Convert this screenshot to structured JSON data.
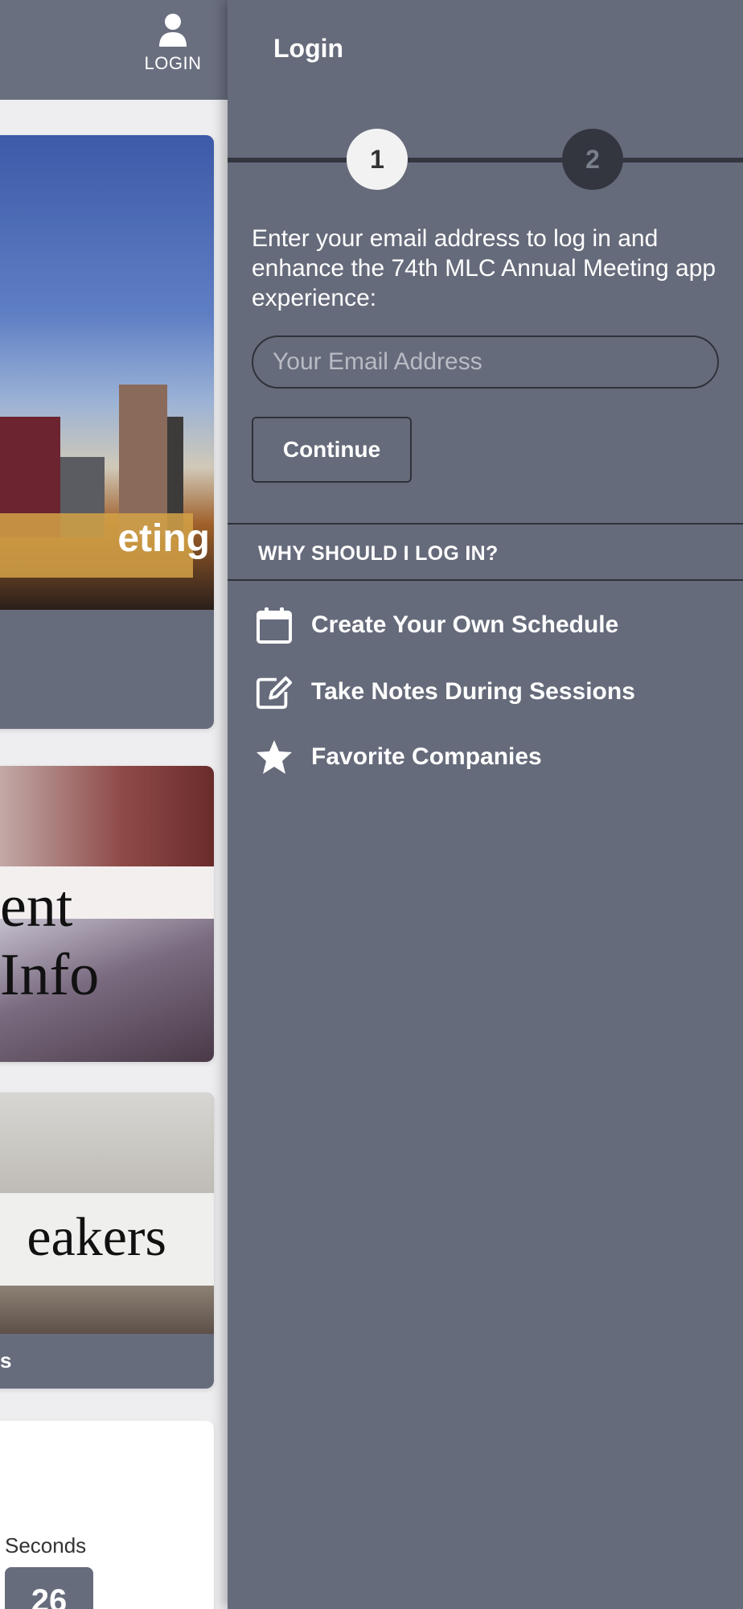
{
  "header": {
    "login_label": "LOGIN"
  },
  "cards": {
    "city_title": "eting",
    "info_title": "ent Info",
    "speakers_title": "eakers",
    "speakers_sub": "s",
    "countdown_label": "Seconds",
    "countdown_value": "26"
  },
  "login_panel": {
    "title": "Login",
    "steps": [
      "1",
      "2"
    ],
    "active_step": 1,
    "intro": "Enter your email address to log in and enhance the 74th MLC Annual Meeting app experience:",
    "email_placeholder": "Your Email Address",
    "email_value": "",
    "continue_label": "Continue",
    "why_header": "WHY SHOULD I LOG IN?",
    "benefits": [
      {
        "icon": "calendar-icon",
        "label": "Create Your Own Schedule"
      },
      {
        "icon": "edit-note-icon",
        "label": "Take Notes During Sessions"
      },
      {
        "icon": "star-icon",
        "label": "Favorite Companies"
      }
    ]
  },
  "colors": {
    "panel_bg": "#666b7b",
    "header_bg": "#6a6f80",
    "stepper_dark": "#33363f",
    "step_active_bg": "#f2f2f2"
  }
}
